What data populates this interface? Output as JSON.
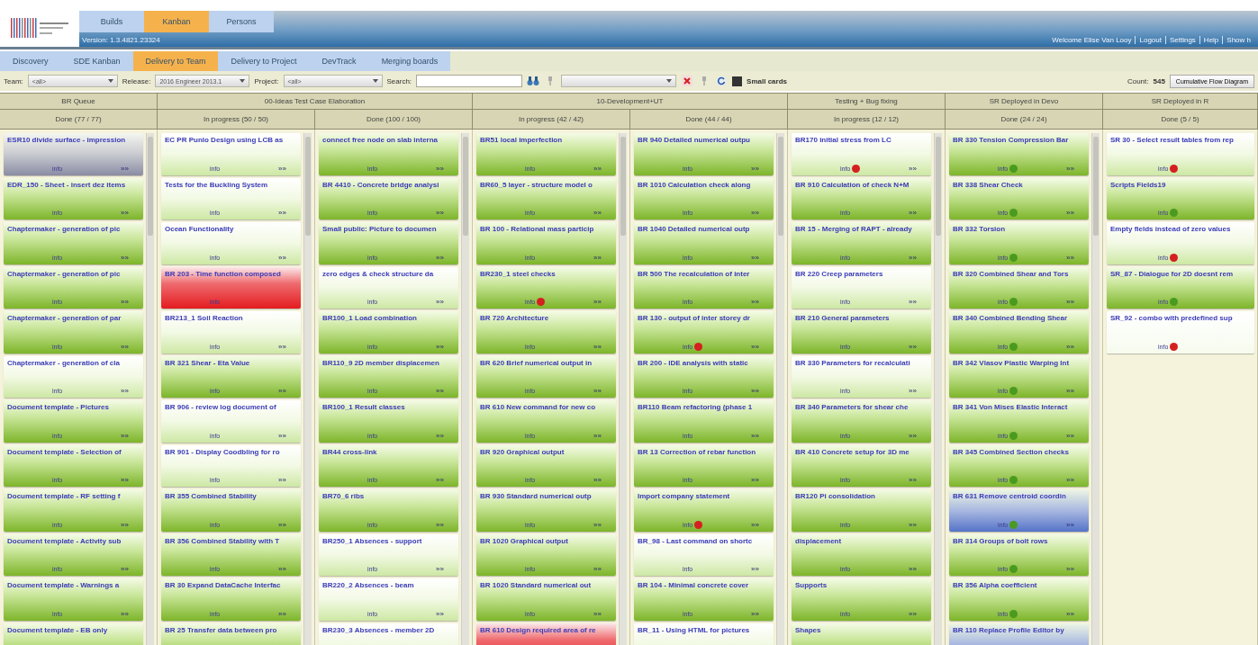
{
  "top_tabs": [
    {
      "label": "Builds",
      "selected": false
    },
    {
      "label": "Kanban",
      "selected": true
    },
    {
      "label": "Persons",
      "selected": false
    }
  ],
  "version": "Version: 1.3.4821.23324",
  "user_links": [
    "Welcome Elise Van Looy",
    "Logout",
    "Settings",
    "Help",
    "Show h"
  ],
  "board_tabs": [
    {
      "label": "Discovery",
      "selected": false
    },
    {
      "label": "SDE Kanban",
      "selected": false
    },
    {
      "label": "Delivery to Team",
      "selected": true
    },
    {
      "label": "Delivery to Project",
      "selected": false
    },
    {
      "label": "DevTrack",
      "selected": false
    },
    {
      "label": "Merging boards",
      "selected": false
    }
  ],
  "filters": {
    "team_label": "Team:",
    "team": "<all>",
    "release_label": "Release:",
    "release": "2016 Engineer 2013.1",
    "project_label": "Project:",
    "project": "<all>",
    "search_label": "Search:",
    "small_cards_label": "Small cards",
    "small_cards": true,
    "count_label": "Count:",
    "count": "545",
    "chart_button": "Cumulative Flow Diagram"
  },
  "groups": [
    {
      "title": "BR Queue",
      "lanes": [
        {
          "title": "Done (77 / 77)",
          "cards": [
            {
              "title": "ESR10 divide surface - impression",
              "kind": "grey",
              "info": "info",
              "more": "»»"
            },
            {
              "title": "EDR_150 - Sheet - insert dez items",
              "kind": "green",
              "info": "info",
              "more": "»»"
            },
            {
              "title": "Chaptermaker - generation of pic",
              "kind": "green",
              "info": "info",
              "more": "»»"
            },
            {
              "title": "Chaptermaker - generation of pic",
              "kind": "green",
              "info": "info",
              "more": "»»"
            },
            {
              "title": "Chaptermaker - generation of par",
              "kind": "green",
              "info": "info",
              "more": "»»"
            },
            {
              "title": "Chaptermaker - generation of cla",
              "kind": "pale",
              "info": "info",
              "more": "»»"
            },
            {
              "title": "Document template - Pictures",
              "kind": "green",
              "info": "info",
              "more": "»»"
            },
            {
              "title": "Document template - Selection of",
              "kind": "green",
              "info": "info",
              "more": "»»"
            },
            {
              "title": "Document template - RF setting f",
              "kind": "green",
              "info": "info",
              "more": "»»"
            },
            {
              "title": "Document template - Activity sub",
              "kind": "green",
              "info": "info",
              "more": "»»"
            },
            {
              "title": "Document template - Warnings a",
              "kind": "green",
              "info": "info",
              "more": "»»"
            },
            {
              "title": "Document template - EB only",
              "kind": "green"
            }
          ]
        }
      ]
    },
    {
      "title": "00-Ideas Test Case Elaboration",
      "lanes": [
        {
          "title": "In progress (50 / 50)",
          "cards": [
            {
              "title": "EC PR Punlo Design using LCB as",
              "kind": "pale",
              "info": "info",
              "more": "»»"
            },
            {
              "title": "Tests for the Buckling System",
              "kind": "pale",
              "info": "info",
              "more": "»»"
            },
            {
              "title": "Ocean Functionality",
              "kind": "pale",
              "info": "info",
              "more": "»»"
            },
            {
              "title": "BR 203 - Time function composed",
              "kind": "red",
              "info": "info"
            },
            {
              "title": "BR213_1 Soil Reaction",
              "kind": "pale",
              "info": "info",
              "more": "»»"
            },
            {
              "title": "BR 321 Shear - Eta Value",
              "kind": "green",
              "info": "info",
              "more": "»»"
            },
            {
              "title": "BR 906 - review log document of",
              "kind": "pale",
              "info": "info",
              "more": "»»"
            },
            {
              "title": "BR 901 - Display Coodbling for ro",
              "kind": "pale",
              "info": "info",
              "more": "»»"
            },
            {
              "title": "BR 355 Combined Stability",
              "kind": "green",
              "info": "info",
              "more": "»»"
            },
            {
              "title": "BR 356 Combined Stability with T",
              "kind": "green",
              "info": "info",
              "more": "»»"
            },
            {
              "title": "BR 30 Expand DataCache Interfac",
              "kind": "green",
              "info": "info",
              "more": "»»"
            },
            {
              "title": "BR 25 Transfer data between pro",
              "kind": "green"
            }
          ]
        },
        {
          "title": "Done (100 / 100)",
          "cards": [
            {
              "title": "connect free node on slab interna",
              "kind": "green",
              "info": "info",
              "more": "»»"
            },
            {
              "title": "BR 4410 - Concrete bridge analysi",
              "kind": "green",
              "info": "info",
              "more": "»»"
            },
            {
              "title": "Small public: Picture to documen",
              "kind": "green",
              "info": "info",
              "more": "»»"
            },
            {
              "title": "zero edges & check structure da",
              "kind": "pale",
              "info": "info",
              "more": "»»"
            },
            {
              "title": "BR100_1 Load combination",
              "kind": "green",
              "info": "info",
              "more": "»»"
            },
            {
              "title": "BR110_9 2D member displacemen",
              "kind": "green",
              "info": "info",
              "more": "»»"
            },
            {
              "title": "BR100_1 Result classes",
              "kind": "green",
              "info": "info",
              "more": "»»"
            },
            {
              "title": "BR44 cross-link",
              "kind": "green",
              "info": "info",
              "more": "»»"
            },
            {
              "title": "BR70_6 ribs",
              "kind": "green",
              "info": "info",
              "more": "»»"
            },
            {
              "title": "BR250_1 Absences - support",
              "kind": "pale",
              "info": "info",
              "more": "»»"
            },
            {
              "title": "BR220_2 Absences - beam",
              "kind": "pale",
              "info": "info",
              "more": "»»"
            },
            {
              "title": "BR230_3 Absences - member 2D",
              "kind": "pale"
            }
          ]
        }
      ]
    },
    {
      "title": "10-Development+UT",
      "lanes": [
        {
          "title": "In progress (42 / 42)",
          "cards": [
            {
              "title": "BR51 local imperfection",
              "kind": "green",
              "info": "info",
              "more": "»»"
            },
            {
              "title": "BR60_5 layer - structure model o",
              "kind": "green",
              "info": "info",
              "more": "»»"
            },
            {
              "title": "BR 100 - Relational mass particip",
              "kind": "green",
              "info": "info",
              "more": "»»"
            },
            {
              "title": "BR230_1 steel checks",
              "kind": "green",
              "info": "info",
              "more": "»»",
              "color": "#d42020"
            },
            {
              "title": "BR 720 Architecture",
              "kind": "green",
              "info": "info",
              "more": "»»"
            },
            {
              "title": "BR 620 Brief numerical output in",
              "kind": "green",
              "info": "info",
              "more": "»»"
            },
            {
              "title": "BR 610 New command for new co",
              "kind": "green",
              "info": "info",
              "more": "»»"
            },
            {
              "title": "BR 920 Graphical output",
              "kind": "green",
              "info": "info",
              "more": "»»"
            },
            {
              "title": "BR 930 Standard numerical outp",
              "kind": "green",
              "info": "info",
              "more": "»»"
            },
            {
              "title": "BR 1020 Graphical output",
              "kind": "green",
              "info": "info",
              "more": "»»"
            },
            {
              "title": "BR 1020 Standard numerical out",
              "kind": "green",
              "info": "info",
              "more": "»»"
            },
            {
              "title": "BR 610 Design required area of re",
              "kind": "red"
            }
          ]
        },
        {
          "title": "Done (44 / 44)",
          "cards": [
            {
              "title": "BR 940 Detailed numerical outpu",
              "kind": "green",
              "info": "info",
              "more": "»»"
            },
            {
              "title": "BR 1010 Calculation check along",
              "kind": "green",
              "info": "info",
              "more": "»»"
            },
            {
              "title": "BR 1040 Detailed numerical outp",
              "kind": "green",
              "info": "info",
              "more": "»»"
            },
            {
              "title": "BR 500 The recalculation of inter",
              "kind": "green",
              "info": "info",
              "more": "»»"
            },
            {
              "title": "BR 130 - output of inter storey dr",
              "kind": "green",
              "info": "info",
              "more": "»»",
              "color": "#d42020"
            },
            {
              "title": "BR 200 - IDE analysis with static",
              "kind": "green",
              "info": "info",
              "more": "»»"
            },
            {
              "title": "BR110 Beam refactoring (phase 1",
              "kind": "green",
              "info": "info",
              "more": "»»"
            },
            {
              "title": "BR 13 Correction of rebar function",
              "kind": "green",
              "info": "info",
              "more": "»»"
            },
            {
              "title": "Import company statement",
              "kind": "green",
              "info": "info",
              "more": "»»",
              "color": "#d42020"
            },
            {
              "title": "BR_98 - Last command on shortc",
              "kind": "pale",
              "info": "info",
              "more": "»»"
            },
            {
              "title": "BR 104 - Minimal concrete cover",
              "kind": "green",
              "info": "info",
              "more": "»»"
            },
            {
              "title": "BR_11 - Using HTML for pictures",
              "kind": "pale"
            }
          ]
        }
      ]
    },
    {
      "title": "Testing + Bug fixing",
      "lanes": [
        {
          "title": "In progress (12 / 12)",
          "cards": [
            {
              "title": "BR170 initial stress from LC",
              "kind": "pale",
              "info": "info",
              "more": "»»",
              "color": "#d42020"
            },
            {
              "title": "BR 910 Calculation of check N+M",
              "kind": "green",
              "info": "info",
              "more": "»»"
            },
            {
              "title": "BR 15 - Merging of RAPT - already",
              "kind": "green",
              "info": "info",
              "more": "»»"
            },
            {
              "title": "BR 220 Creep parameters",
              "kind": "pale",
              "info": "info",
              "more": "»»"
            },
            {
              "title": "BR 210 General parameters",
              "kind": "green",
              "info": "info",
              "more": "»»"
            },
            {
              "title": "BR 330 Parameters for recalculati",
              "kind": "pale",
              "info": "info",
              "more": "»»"
            },
            {
              "title": "BR 340 Parameters for shear che",
              "kind": "green",
              "info": "info",
              "more": "»»"
            },
            {
              "title": "BR 410 Concrete setup for 3D me",
              "kind": "green",
              "info": "info",
              "more": "»»"
            },
            {
              "title": "BR120 Pi consolidation",
              "kind": "green",
              "info": "info",
              "more": "»»"
            },
            {
              "title": "displacement",
              "kind": "green",
              "info": "info",
              "more": "»»"
            },
            {
              "title": "Supports",
              "kind": "green",
              "info": "info",
              "more": "»»"
            },
            {
              "title": "Shapes",
              "kind": "green"
            }
          ]
        }
      ]
    },
    {
      "title": "SR Deployed in Devo",
      "lanes": [
        {
          "title": "Done (24 / 24)",
          "cards": [
            {
              "title": "BR 330 Tension Compression Bar",
              "kind": "green",
              "info": "info",
              "more": "»»",
              "color": "#4a9a20"
            },
            {
              "title": "BR 338 Shear Check",
              "kind": "green",
              "info": "info",
              "more": "»»",
              "color": "#4a9a20"
            },
            {
              "title": "BR 332 Torsion",
              "kind": "green",
              "info": "info",
              "more": "»»",
              "color": "#4a9a20"
            },
            {
              "title": "BR 320 Combined Shear and Tors",
              "kind": "green",
              "info": "info",
              "more": "»»",
              "color": "#4a9a20"
            },
            {
              "title": "BR 340 Combined Bending Shear",
              "kind": "green",
              "info": "info",
              "more": "»»",
              "color": "#4a9a20"
            },
            {
              "title": "BR 342 Vlasov Plastic Warping Int",
              "kind": "green",
              "info": "info",
              "more": "»»",
              "color": "#4a9a20"
            },
            {
              "title": "BR 341 Von Mises Elastic Interact",
              "kind": "green",
              "info": "info",
              "more": "»»",
              "color": "#4a9a20"
            },
            {
              "title": "BR 345 Combined Section checks",
              "kind": "green",
              "info": "info",
              "more": "»»",
              "color": "#4a9a20"
            },
            {
              "title": "BR 631 Remove centroid coordin",
              "kind": "blue",
              "info": "info",
              "more": "»»",
              "color": "#4a9a20"
            },
            {
              "title": "BR 314 Groups of bolt rows",
              "kind": "green",
              "info": "info",
              "more": "»»",
              "color": "#4a9a20"
            },
            {
              "title": "BR 356 Alpha coefficient",
              "kind": "green",
              "info": "info",
              "more": "»»",
              "color": "#4a9a20"
            },
            {
              "title": "BR 110 Replace Profile Editor by",
              "kind": "blue"
            }
          ]
        }
      ]
    },
    {
      "title": "SR Deployed in R",
      "lanes": [
        {
          "title": "Done (5 / 5)",
          "cards": [
            {
              "title": "SR 30 - Select result tables from rep",
              "kind": "pale",
              "info": "info",
              "color": "#d42020"
            },
            {
              "title": "Scripts Fields19",
              "kind": "green",
              "info": "info",
              "color": "#4a9a20"
            },
            {
              "title": "Empty fields instead of zero values",
              "kind": "pale",
              "info": "info",
              "color": "#d42020"
            },
            {
              "title": "SR_87 - Dialogue for 2D doesnt rem",
              "kind": "green",
              "info": "info",
              "color": "#4a9a20"
            },
            {
              "title": "SR_92 - combo with predefined sup",
              "kind": "white",
              "info": "info",
              "color": "#d42020"
            }
          ]
        }
      ]
    }
  ]
}
